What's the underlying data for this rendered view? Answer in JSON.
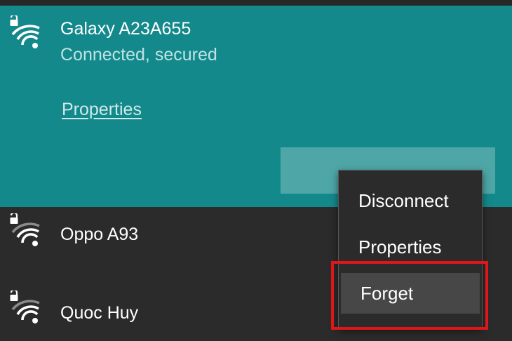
{
  "networks": {
    "active": {
      "name": "Galaxy A23A655",
      "status": "Connected, secured",
      "properties_link": "Properties",
      "disconnect_label": "Disconnect",
      "icon": "wifi-secured-icon"
    },
    "others": [
      {
        "name": "Oppo A93",
        "icon": "wifi-secured-icon"
      },
      {
        "name": "Quoc Huy",
        "icon": "wifi-secured-icon"
      }
    ]
  },
  "context_menu": {
    "items": [
      {
        "label": "Disconnect"
      },
      {
        "label": "Properties"
      },
      {
        "label": "Forget"
      }
    ],
    "hovered_item": "Forget",
    "highlight_color": "#e0161b"
  },
  "colors": {
    "active_background": "#13898c",
    "panel_background": "#2b2b2b",
    "menu_hover": "#474747"
  }
}
